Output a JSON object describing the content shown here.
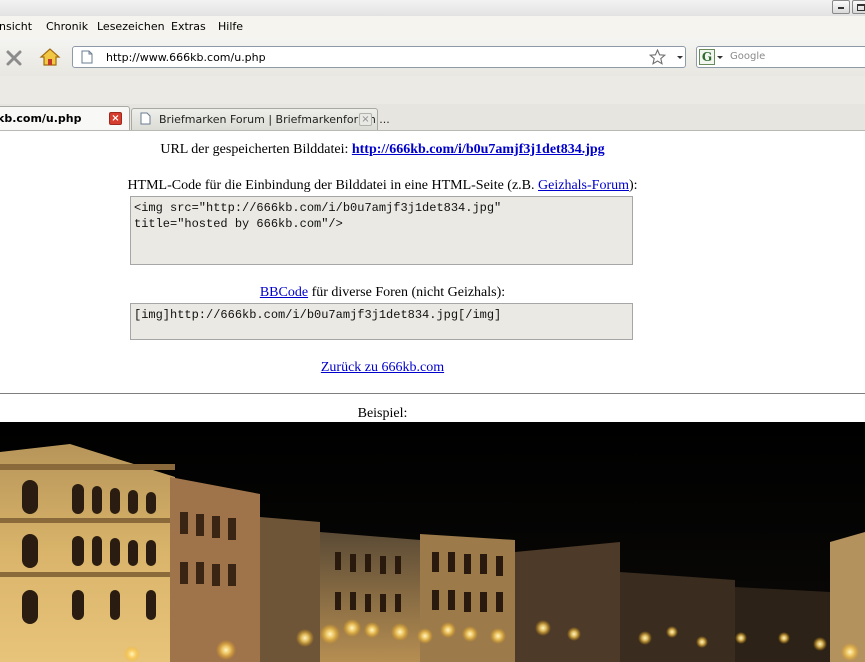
{
  "menu": {
    "items": [
      "nsicht",
      "Chronik",
      "Lesezeichen",
      "Extras",
      "Hilfe"
    ]
  },
  "navbar": {
    "url": "http://www.666kb.com/u.php",
    "search_placeholder": "Google",
    "search_engine_icon": "G"
  },
  "tabs": [
    {
      "label": "kb.com/u.php",
      "active": true
    },
    {
      "label": "Briefmarken Forum | Briefmarkenforum ...",
      "active": false
    }
  ],
  "page": {
    "url_label": "URL der gespeicherten Bilddatei:",
    "url_link": "http://666kb.com/i/b0u7amjf3j1det834.jpg",
    "html_label_before": "HTML-Code für die Einbindung der Bilddatei in eine HTML-Seite (z.B.",
    "html_label_link": "Geizhals-Forum",
    "html_label_after": "):",
    "html_code": "<img src=\"http://666kb.com/i/b0u7amjf3j1det834.jpg\"\ntitle=\"hosted by 666kb.com\"/>",
    "bbcode_link": "BBCode",
    "bbcode_label_after": "für diverse Foren (nicht Geizhals):",
    "bbcode_code": "[img]http://666kb.com/i/b0u7amjf3j1det834.jpg[/img]",
    "back_link": "Zurück zu 666kb.com",
    "example_label": "Beispiel:"
  },
  "colors": {
    "link": "#0000cc",
    "code_bg": "#ebe9e4",
    "tab_close_active": "#d63d2e"
  }
}
